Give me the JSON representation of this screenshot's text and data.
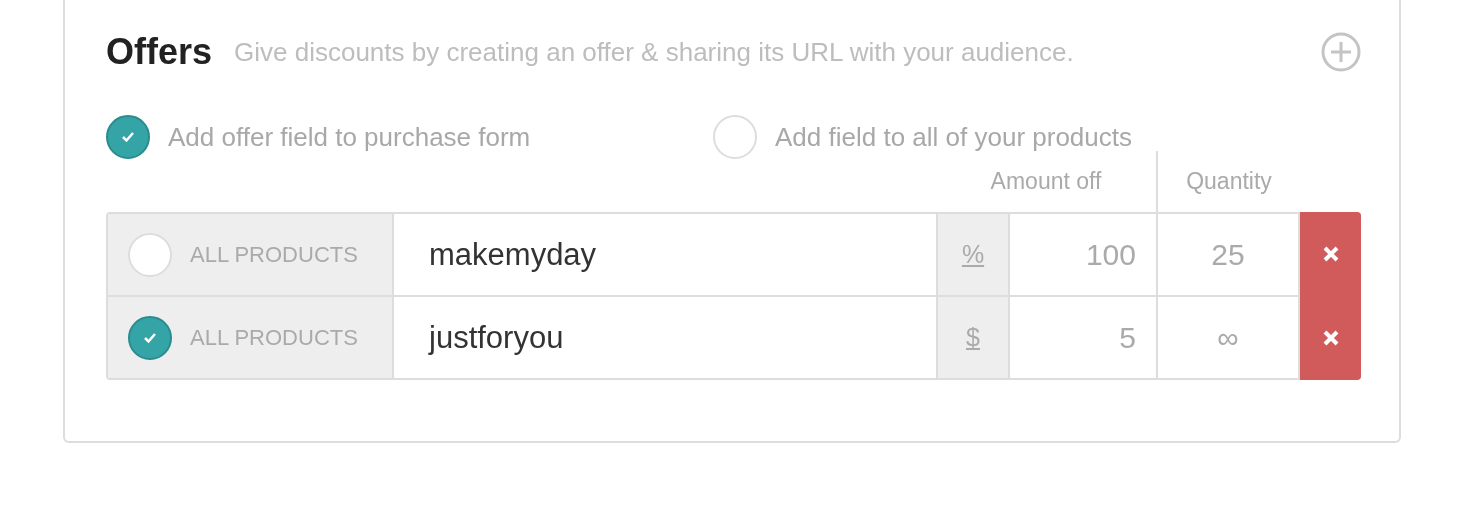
{
  "section": {
    "title": "Offers",
    "description": "Give discounts by creating an offer & sharing its URL with your audience."
  },
  "options": [
    {
      "label": "Add offer field to purchase form",
      "checked": true
    },
    {
      "label": "Add field to all of your products",
      "checked": false
    }
  ],
  "columns": [
    "Amount off",
    "Quantity"
  ],
  "offers": [
    {
      "checked": false,
      "scope": "ALL PRODUCTS",
      "code": "makemyday",
      "unit": "%",
      "amount": "100",
      "quantity": "25"
    },
    {
      "checked": true,
      "scope": "ALL PRODUCTS",
      "code": "justforyou",
      "unit": "$",
      "amount": "5",
      "quantity": "∞"
    }
  ]
}
